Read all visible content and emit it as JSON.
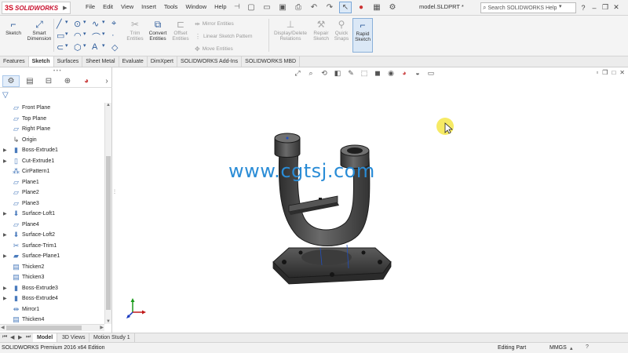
{
  "app": {
    "brand_mark": "3S",
    "brand_name": "SOLIDWORKS",
    "document_title": "model.SLDPRT *"
  },
  "menu": [
    "File",
    "Edit",
    "View",
    "Insert",
    "Tools",
    "Window",
    "Help"
  ],
  "search": {
    "placeholder": "Search SOLIDWORKS Help"
  },
  "ribbon": {
    "sketch": "Sketch",
    "smart_dimension": "Smart Dimension",
    "trim_entities": "Trim Entities",
    "convert_entities": "Convert Entities",
    "offset_entities": "Offset Entities",
    "mirror_entities": "Mirror Entities",
    "linear_sketch_pattern": "Linear Sketch Pattern",
    "move_entities": "Move Entities",
    "display_delete_relations": "Display/Delete Relations",
    "repair_sketch": "Repair Sketch",
    "quick_snaps": "Quick Snaps",
    "rapid_sketch": "Rapid Sketch"
  },
  "tabs": [
    "Features",
    "Sketch",
    "Surfaces",
    "Sheet Metal",
    "Evaluate",
    "DimXpert",
    "SOLIDWORKS Add-Ins",
    "SOLIDWORKS MBD"
  ],
  "active_tab": "Sketch",
  "tree": [
    {
      "label": "Front Plane",
      "icon": "plane-icon",
      "expand": false
    },
    {
      "label": "Top Plane",
      "icon": "plane-icon",
      "expand": false
    },
    {
      "label": "Right Plane",
      "icon": "plane-icon",
      "expand": false
    },
    {
      "label": "Origin",
      "icon": "origin-icon",
      "expand": false
    },
    {
      "label": "Boss-Extrude1",
      "icon": "boss-extrude-icon",
      "expand": true
    },
    {
      "label": "Cut-Extrude1",
      "icon": "cut-extrude-icon",
      "expand": true
    },
    {
      "label": "CirPattern1",
      "icon": "circular-pattern-icon",
      "expand": false
    },
    {
      "label": "Plane1",
      "icon": "plane-icon",
      "expand": false
    },
    {
      "label": "Plane2",
      "icon": "plane-icon",
      "expand": false
    },
    {
      "label": "Plane3",
      "icon": "plane-icon",
      "expand": false
    },
    {
      "label": "Surface-Loft1",
      "icon": "surface-loft-icon",
      "expand": true
    },
    {
      "label": "Plane4",
      "icon": "plane-icon",
      "expand": false
    },
    {
      "label": "Surface-Loft2",
      "icon": "surface-loft-icon",
      "expand": true
    },
    {
      "label": "Surface-Trim1",
      "icon": "surface-trim-icon",
      "expand": false
    },
    {
      "label": "Surface-Plane1",
      "icon": "surface-plane-icon",
      "expand": true
    },
    {
      "label": "Thicken2",
      "icon": "thicken-icon",
      "expand": false
    },
    {
      "label": "Thicken3",
      "icon": "thicken-icon",
      "expand": false
    },
    {
      "label": "Boss-Extrude3",
      "icon": "boss-extrude-icon",
      "expand": true
    },
    {
      "label": "Boss-Extrude4",
      "icon": "boss-extrude-icon",
      "expand": true
    },
    {
      "label": "Mirror1",
      "icon": "mirror-icon",
      "expand": false
    },
    {
      "label": "Thicken4",
      "icon": "thicken-icon",
      "expand": false
    }
  ],
  "viewport": {
    "watermark": "www.cgtsj.com"
  },
  "bottom_tabs": [
    "Model",
    "3D Views",
    "Motion Study 1"
  ],
  "active_bottom_tab": "Model",
  "status": {
    "edition": "SOLIDWORKS Premium 2016 x64 Edition",
    "mode": "Editing Part",
    "units": "MMGS",
    "help": "?"
  },
  "colors": {
    "accent": "#2f5d9b",
    "brand_red": "#c8102e",
    "watermark": "#2a8cd6",
    "part_body": "#4a4a4a"
  }
}
